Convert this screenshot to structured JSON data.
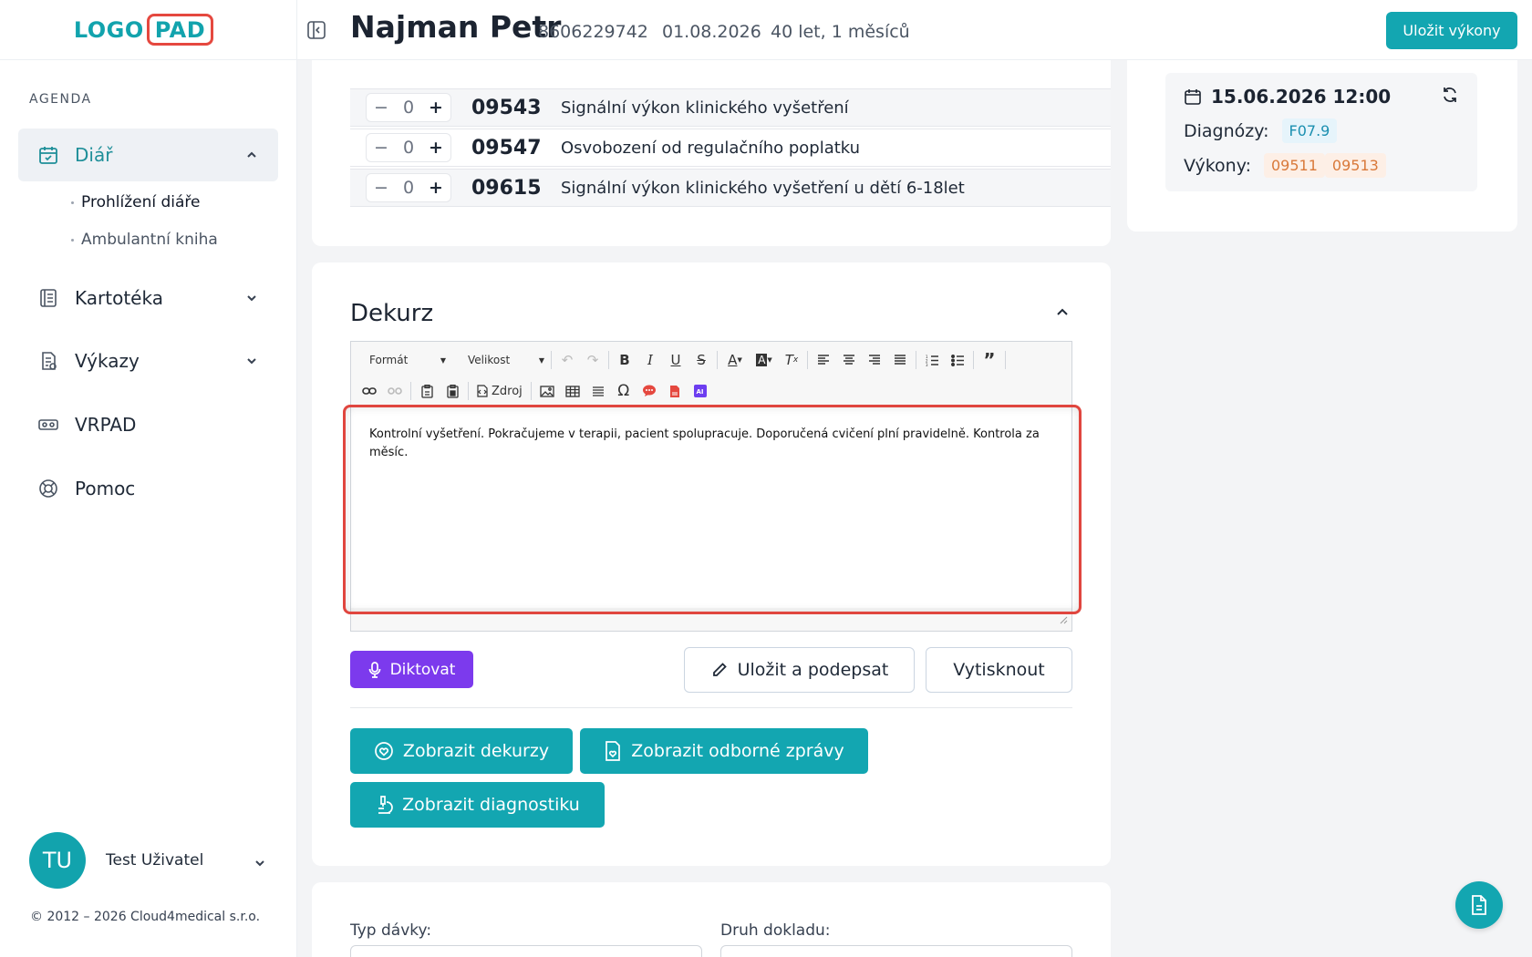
{
  "brand": {
    "logo_left": "LOGO",
    "logo_right": "PAD"
  },
  "header": {
    "patient_name": "Najman Petr",
    "birth_number": "8606229742",
    "date": "01.08.2026",
    "age": "40 let, 1 měsíců",
    "save_button": "Uložit výkony"
  },
  "sidebar": {
    "section_label": "AGENDA",
    "items": [
      {
        "label": "Diář",
        "icon": "calendar-icon",
        "active": true
      },
      {
        "label": "Kartotéka",
        "icon": "card-index-icon"
      },
      {
        "label": "Výkazy",
        "icon": "report-icon"
      },
      {
        "label": "VRPAD",
        "icon": "vr-headset-icon"
      },
      {
        "label": "Pomoc",
        "icon": "lifebuoy-icon"
      }
    ],
    "subitems": [
      {
        "label": "Prohlížení diáře",
        "active": true
      },
      {
        "label": "Ambulantní kniha"
      }
    ],
    "user": {
      "initials": "TU",
      "name": "Test Uživatel"
    },
    "copyright": "© 2012 – 2026 Cloud4medical s.r.o."
  },
  "procedures": [
    {
      "qty": "0",
      "code": "09543",
      "desc": "Signální výkon klinického vyšetření"
    },
    {
      "qty": "0",
      "code": "09547",
      "desc": "Osvobození od regulačního poplatku"
    },
    {
      "qty": "0",
      "code": "09615",
      "desc": "Signální výkon klinického vyšetření u dětí 6-18let"
    }
  ],
  "dekurz": {
    "title": "Dekurz",
    "toolbar": {
      "format": "Formát",
      "size": "Velikost",
      "source": "Zdroj"
    },
    "content": "Kontrolní vyšetření. Pokračujeme v terapii, pacient spolupracuje. Doporučená cvičení plní pravidelně. Kontrola za měsíc.",
    "dictate": "Diktovat",
    "save_sign": "Uložit a podepsat",
    "print": "Vytisknout",
    "show_dekurzy": "Zobrazit dekurzy",
    "show_reports": "Zobrazit odborné zprávy",
    "show_diagnostics": "Zobrazit diagnostiku"
  },
  "form": {
    "batch_type_label": "Typ dávky:",
    "doc_type_label": "Druh dokladu:"
  },
  "visit": {
    "datetime": "15.06.2026 12:00",
    "diagnoses_label": "Diagnózy:",
    "diagnoses": [
      "F07.9"
    ],
    "procedures_label": "Výkony:",
    "procedures": [
      "09511",
      "09513"
    ]
  },
  "colors": {
    "brand_teal": "#13a6b1",
    "dictate_purple": "#7c3aed",
    "highlight_red": "#e0463f"
  }
}
